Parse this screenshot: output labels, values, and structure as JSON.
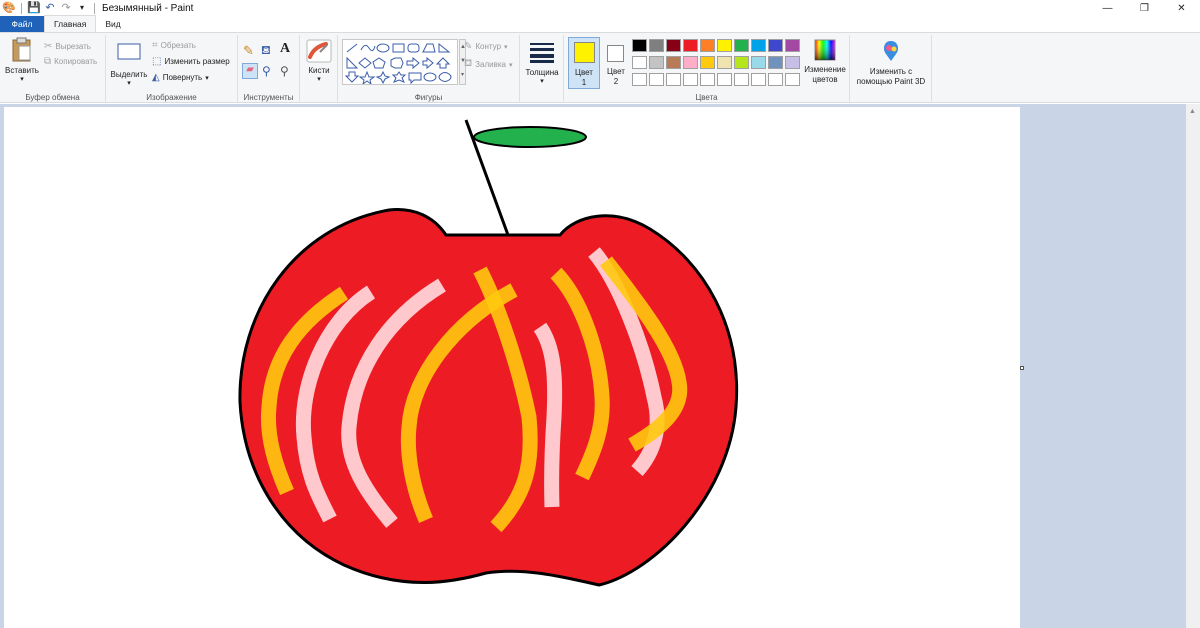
{
  "window": {
    "title": "Безымянный - Paint",
    "minimize": "—",
    "maximize": "❐",
    "close": "✕"
  },
  "tabs": {
    "file": "Файл",
    "home": "Главная",
    "view": "Вид"
  },
  "ribbon": {
    "clipboard": {
      "paste": "Вставить",
      "cut": "Вырезать",
      "copy": "Копировать",
      "label": "Буфер обмена"
    },
    "image": {
      "select": "Выделить",
      "crop": "Обрезать",
      "resize": "Изменить размер",
      "rotate": "Повернуть",
      "label": "Изображение"
    },
    "tools": {
      "label": "Инструменты"
    },
    "brushes": {
      "label": "Кисти"
    },
    "shapes": {
      "outline": "Контур",
      "fill": "Заливка",
      "label": "Фигуры"
    },
    "size": {
      "label": "Толщина"
    },
    "colors": {
      "color1": "Цвет",
      "color1_num": "1",
      "color2": "Цвет",
      "color2_num": "2",
      "edit_colors": "Изменение цветов",
      "label": "Цвета",
      "color1_value": "#fff200",
      "color2_value": "#ffffff",
      "palette_row1": [
        "#000000",
        "#7f7f7f",
        "#880015",
        "#ed1c24",
        "#ff7f27",
        "#fff200",
        "#22b14c",
        "#00a2e8",
        "#3f48cc",
        "#a349a4"
      ],
      "palette_row2": [
        "#ffffff",
        "#c3c3c3",
        "#b97a57",
        "#ffaec9",
        "#ffc90e",
        "#efe4b0",
        "#b5e61d",
        "#99d9ea",
        "#7092be",
        "#c8bfe7"
      ],
      "palette_row3": [
        "#ffffff",
        "#ffffff",
        "#ffffff",
        "#ffffff",
        "#ffffff",
        "#ffffff",
        "#ffffff",
        "#ffffff",
        "#ffffff",
        "#ffffff"
      ]
    },
    "paint3d": {
      "label": "Изменить с помощью Paint 3D"
    }
  },
  "drawing": {
    "apple_color": "#ed1c24",
    "leaf_color": "#22b14c",
    "stripe_orange": "#ffc90e",
    "stripe_pink": "#ffc8cc"
  }
}
